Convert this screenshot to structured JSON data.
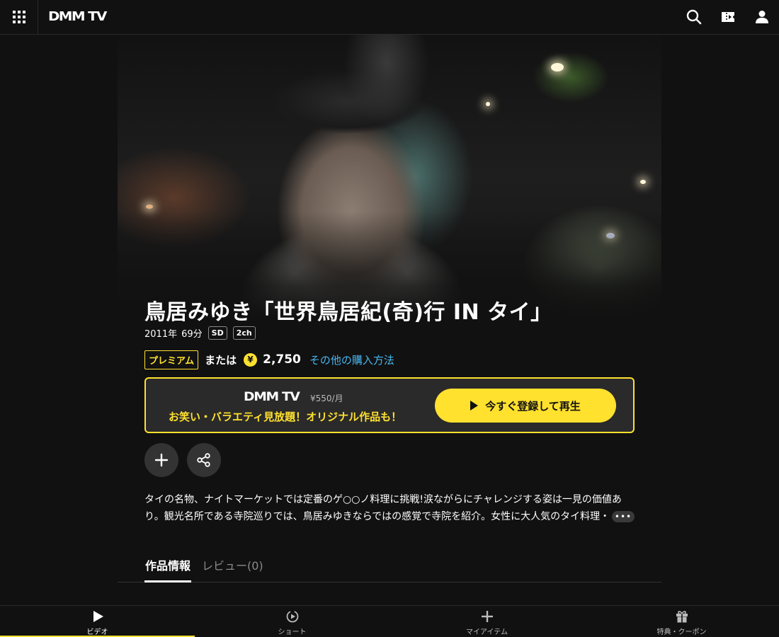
{
  "header": {
    "logo": "DMM TV"
  },
  "title": {
    "text": "鳥居みゆき「世界鳥居紀(奇)行 IN タイ」",
    "year": "2011年",
    "duration": "69分",
    "tags": [
      "SD",
      "2ch"
    ]
  },
  "price": {
    "premium_badge": "プレミアム",
    "or_text": "または",
    "yen_symbol": "¥",
    "amount": "2,750",
    "other_purchase_link": "その他の購入方法"
  },
  "promo": {
    "logo": "DMM TV",
    "monthly_price": "¥550/月",
    "tagline": "お笑い・バラエティ見放題！オリジナル作品も！",
    "cta_label": "今すぐ登録して再生"
  },
  "description": {
    "text": "タイの名物、ナイトマーケットでは定番のゲ○○ノ料理に挑戦!涙ながらにチャレンジする姿は一見の価値あり。観光名所である寺院巡りでは、鳥居みゆきならではの感覚で寺院を紹介。女性に大人気のタイ料理・",
    "more_label": "•••"
  },
  "tabs": {
    "info": "作品情報",
    "review": "レビュー(0)"
  },
  "bottom_nav": {
    "items": [
      {
        "label": "ビデオ",
        "icon": "play-icon",
        "active": true
      },
      {
        "label": "ショート",
        "icon": "short-video-icon",
        "active": false
      },
      {
        "label": "マイアイテム",
        "icon": "plus-icon",
        "active": false
      },
      {
        "label": "特典・クーポン",
        "icon": "gift-icon",
        "active": false
      }
    ]
  },
  "colors": {
    "accent_yellow": "#ffe12e",
    "link_blue": "#4ab6f0",
    "background": "#111111"
  }
}
